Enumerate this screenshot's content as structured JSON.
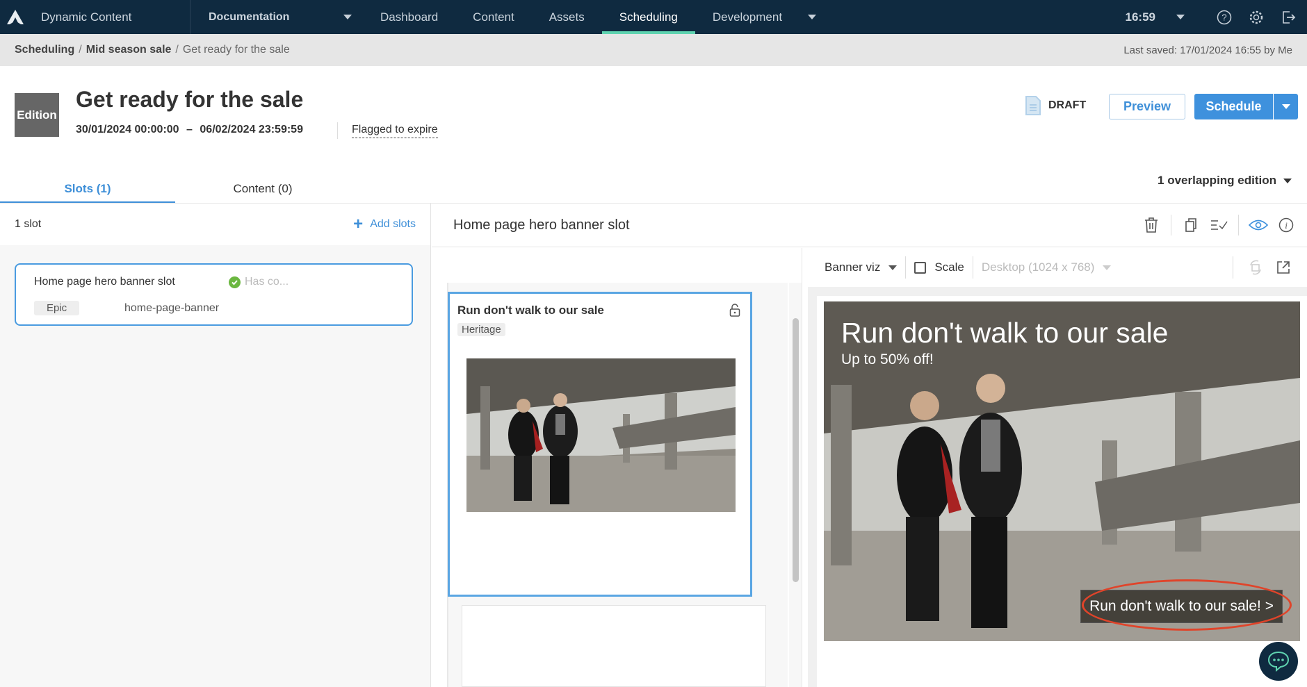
{
  "topnav": {
    "app_name": "Dynamic Content",
    "hub": "Documentation",
    "tabs": [
      "Dashboard",
      "Content",
      "Assets",
      "Scheduling",
      "Development"
    ],
    "active_tab": "Scheduling",
    "time": "16:59"
  },
  "breadcrumb": {
    "items": [
      "Scheduling",
      "Mid season sale",
      "Get ready for the sale"
    ],
    "last_saved": "Last saved: 17/01/2024 16:55 by Me"
  },
  "header": {
    "badge": "Edition",
    "title": "Get ready for the sale",
    "start": "30/01/2024 00:00:00",
    "range_sep": "–",
    "end": "06/02/2024 23:59:59",
    "flag": "Flagged to expire",
    "status": "DRAFT",
    "preview_label": "Preview",
    "schedule_label": "Schedule"
  },
  "tabs": [
    {
      "label": "Slots (1)",
      "active": true
    },
    {
      "label": "Content (0)",
      "active": false
    }
  ],
  "overlap": "1 overlapping edition",
  "slots_panel": {
    "count": "1 slot",
    "add_label": "Add slots",
    "slot": {
      "name": "Home page hero banner slot",
      "status": "Has co...",
      "tag": "Epic",
      "key": "home-page-banner"
    }
  },
  "main": {
    "title": "Home page hero banner slot",
    "content_item": {
      "title": "Run don't walk to our sale",
      "tag": "Heritage"
    },
    "preview": {
      "viz": "Banner viz",
      "scale_label": "Scale",
      "scale_checked": false,
      "device": "Desktop (1024 x 768)",
      "banner_heading": "Run don't walk to our sale",
      "banner_sub": "Up to 50% off!",
      "banner_cta": "Run don't walk to our sale! >"
    }
  },
  "colors": {
    "nav_bg": "#0f2a40",
    "accent": "#3e91dd",
    "active_tab_indicator": "#5fd3b0",
    "success": "#6bb740",
    "annotation_ring": "#e0442a"
  }
}
